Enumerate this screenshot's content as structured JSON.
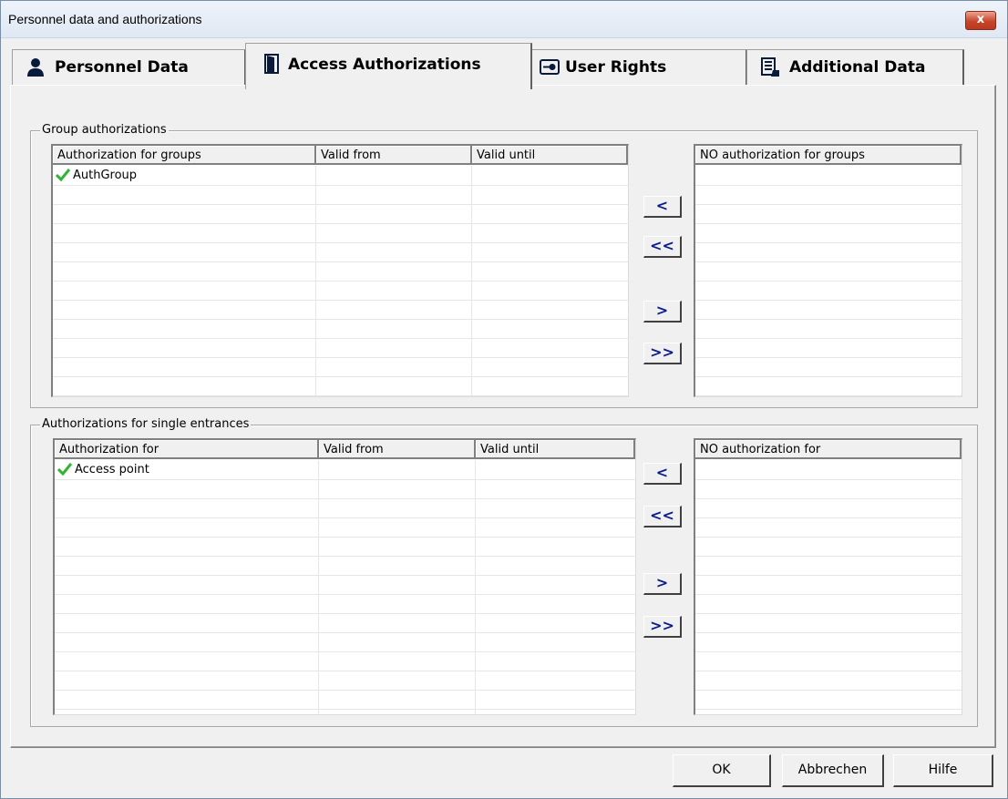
{
  "window": {
    "title": "Personnel data and authorizations",
    "close_label": "x"
  },
  "tabs": [
    {
      "label": "Personnel Data",
      "icon": "person-icon"
    },
    {
      "label": "Access Authorizations",
      "icon": "door-icon"
    },
    {
      "label": "User Rights",
      "icon": "key-card-icon"
    },
    {
      "label": "Additional Data",
      "icon": "disk-document-icon"
    }
  ],
  "active_tab": "Access Authorizations",
  "groups": {
    "legend": "Group authorizations",
    "left_columns": [
      "Authorization for groups",
      "Valid from",
      "Valid until"
    ],
    "rows": [
      {
        "name": "AuthGroup",
        "valid_from": "",
        "valid_until": "",
        "checked": true
      }
    ],
    "right_column": "NO authorization for groups",
    "buttons": {
      "add_one": "<",
      "add_all": "<<",
      "remove_one": ">",
      "remove_all": ">>"
    }
  },
  "entrances": {
    "legend": "Authorizations for single entrances",
    "left_columns": [
      "Authorization for",
      "Valid from",
      "Valid until"
    ],
    "rows": [
      {
        "name": "Access point",
        "valid_from": "",
        "valid_until": "",
        "checked": true
      }
    ],
    "right_column": "NO authorization for",
    "buttons": {
      "add_one": "<",
      "add_all": "<<",
      "remove_one": ">",
      "remove_all": ">>"
    }
  },
  "footer": {
    "ok": "OK",
    "cancel": "Abbrechen",
    "help": "Hilfe"
  },
  "colors": {
    "check": "#2fb52f",
    "arrow": "#0a1a8a",
    "close": "#c9452a"
  }
}
